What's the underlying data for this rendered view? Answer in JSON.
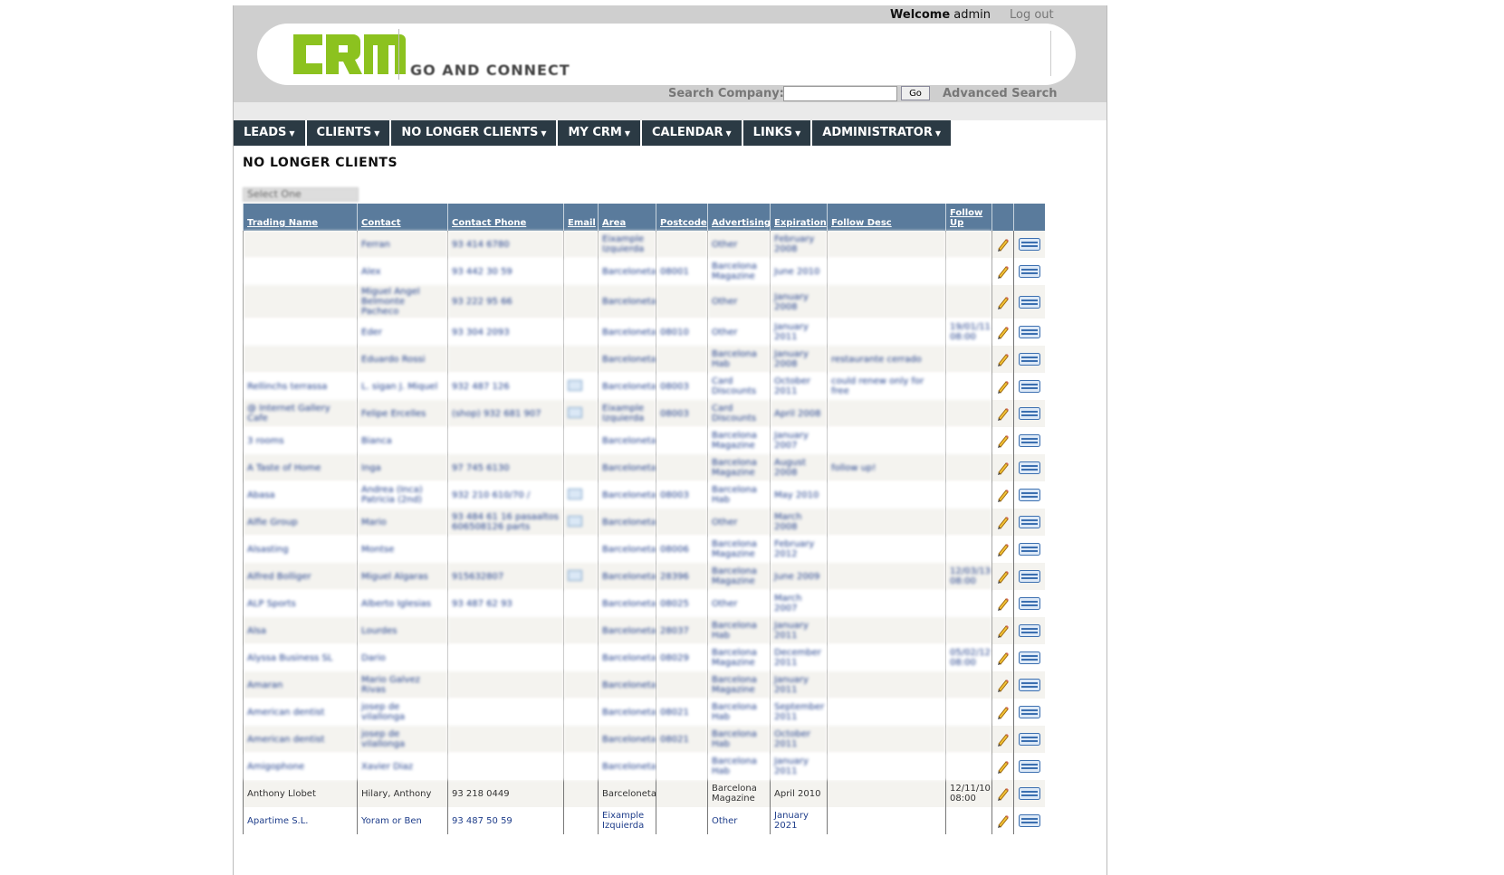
{
  "header": {
    "welcome_label": "Welcome",
    "username": "admin",
    "logout": "Log out",
    "logo_text": "CRM",
    "slogan": "GO AND CONNECT",
    "search_label": "Search Company:",
    "search_value": "",
    "go_button": "Go",
    "advanced_search": "Advanced Search"
  },
  "nav": [
    "LEADS",
    "CLIENTS",
    "NO LONGER CLIENTS",
    "MY CRM",
    "CALENDAR",
    "LINKS",
    "ADMINISTRATOR"
  ],
  "page_title": "NO LONGER CLIENTS",
  "filter_select": "Select One",
  "table": {
    "columns": [
      "Trading Name",
      "Contact",
      "Contact Phone",
      "Email",
      "Area",
      "Postcode",
      "Advertising",
      "Expiration",
      "Follow Desc",
      "Follow Up"
    ],
    "rows": [
      {
        "trading": "",
        "contact": "Ferran",
        "phone": "93 414 6780",
        "email": false,
        "area": "Eixample Izquierda",
        "postcode": "",
        "advertising": "Other",
        "expiration": "February 2008",
        "desc": "",
        "followup": ""
      },
      {
        "trading": "",
        "contact": "Alex",
        "phone": "93 442 30 59",
        "email": false,
        "area": "Barceloneta",
        "postcode": "08001",
        "advertising": "Barcelona Magazine",
        "expiration": "June 2010",
        "desc": "",
        "followup": ""
      },
      {
        "trading": "",
        "contact": "Miguel Angel Belmonte Pacheco",
        "phone": "93 222 95 66",
        "email": false,
        "area": "Barceloneta",
        "postcode": "",
        "advertising": "Other",
        "expiration": "January 2008",
        "desc": "",
        "followup": ""
      },
      {
        "trading": "",
        "contact": "Eder",
        "phone": "93 304 2093",
        "email": false,
        "area": "Barceloneta",
        "postcode": "08010",
        "advertising": "Other",
        "expiration": "January 2011",
        "desc": "",
        "followup": "19/01/11 08:00"
      },
      {
        "trading": "",
        "contact": "Eduardo Rossi",
        "phone": "",
        "email": false,
        "area": "Barceloneta",
        "postcode": "",
        "advertising": "Barcelona Hab",
        "expiration": "January 2008",
        "desc": "restaurante cerrado",
        "followup": ""
      },
      {
        "trading": "Rellinchs terrassa",
        "contact": "L. sigan J. Miquel",
        "phone": "932 487 126",
        "email": true,
        "area": "Barceloneta",
        "postcode": "08003",
        "advertising": "Card Discounts",
        "expiration": "October 2011",
        "desc": "could renew only for free",
        "followup": ""
      },
      {
        "trading": "@ Internet Gallery Cafe",
        "contact": "Felipe Ercelles",
        "phone": "(shop) 932 681 907",
        "email": true,
        "area": "Eixample Izquierda",
        "postcode": "08003",
        "advertising": "Card Discounts",
        "expiration": "April 2008",
        "desc": "",
        "followup": ""
      },
      {
        "trading": "3 rooms",
        "contact": "Bianca",
        "phone": "",
        "email": false,
        "area": "Barceloneta",
        "postcode": "",
        "advertising": "Barcelona Magazine",
        "expiration": "January 2007",
        "desc": "",
        "followup": ""
      },
      {
        "trading": "A Taste of Home",
        "contact": "Inga",
        "phone": "97 745 6130",
        "email": false,
        "area": "Barceloneta",
        "postcode": "",
        "advertising": "Barcelona Magazine",
        "expiration": "August 2008",
        "desc": "follow up!",
        "followup": ""
      },
      {
        "trading": "Abasa",
        "contact": "Andrea (Inca) Patricia (2nd)",
        "phone": "932 210 610/70 /",
        "email": true,
        "area": "Barceloneta",
        "postcode": "08003",
        "advertising": "Barcelona Hab",
        "expiration": "May 2010",
        "desc": "",
        "followup": ""
      },
      {
        "trading": "Alfie Group",
        "contact": "Mario",
        "phone": "93 484 61 16 pasaaltos 606508126 parts",
        "email": true,
        "area": "Barceloneta",
        "postcode": "",
        "advertising": "Other",
        "expiration": "March 2008",
        "desc": "",
        "followup": ""
      },
      {
        "trading": "Alsasting",
        "contact": "Montse",
        "phone": "",
        "email": false,
        "area": "Barceloneta",
        "postcode": "08006",
        "advertising": "Barcelona Magazine",
        "expiration": "February 2012",
        "desc": "",
        "followup": ""
      },
      {
        "trading": "Alfred Bolliger",
        "contact": "Miguel Algaras",
        "phone": "915632807",
        "email": true,
        "area": "Barceloneta",
        "postcode": "28396",
        "advertising": "Barcelona Magazine",
        "expiration": "June 2009",
        "desc": "",
        "followup": "12/03/13 08:00"
      },
      {
        "trading": "ALP Sports",
        "contact": "Alberto Iglesias",
        "phone": "93 487 62 93",
        "email": false,
        "area": "Barceloneta",
        "postcode": "08025",
        "advertising": "Other",
        "expiration": "March 2007",
        "desc": "",
        "followup": ""
      },
      {
        "trading": "Alsa",
        "contact": "Lourdes",
        "phone": "",
        "email": false,
        "area": "Barceloneta",
        "postcode": "28037",
        "advertising": "Barcelona Hab",
        "expiration": "January 2011",
        "desc": "",
        "followup": ""
      },
      {
        "trading": "Alyssa Business SL",
        "contact": "Dario",
        "phone": "",
        "email": false,
        "area": "Barceloneta",
        "postcode": "08029",
        "advertising": "Barcelona Magazine",
        "expiration": "December 2011",
        "desc": "",
        "followup": "05/02/12 08:00"
      },
      {
        "trading": "Amaran",
        "contact": "Mario Galvez Rivas",
        "phone": "",
        "email": false,
        "area": "Barceloneta",
        "postcode": "",
        "advertising": "Barcelona Magazine",
        "expiration": "January 2011",
        "desc": "",
        "followup": ""
      },
      {
        "trading": "American dentist",
        "contact": "josep de vilallonga",
        "phone": "",
        "email": false,
        "area": "Barceloneta",
        "postcode": "08021",
        "advertising": "Barcelona Hab",
        "expiration": "September 2011",
        "desc": "",
        "followup": ""
      },
      {
        "trading": "American dentist",
        "contact": "josep de vilallonga",
        "phone": "",
        "email": false,
        "area": "Barceloneta",
        "postcode": "08021",
        "advertising": "Barcelona Hab",
        "expiration": "October 2011",
        "desc": "",
        "followup": ""
      },
      {
        "trading": "Amigophone",
        "contact": "Xavier Diaz",
        "phone": "",
        "email": false,
        "area": "Barceloneta",
        "postcode": "",
        "advertising": "Barcelona Hab",
        "expiration": "January 2011",
        "desc": "",
        "followup": ""
      },
      {
        "trading": "Anthony Llobet",
        "contact": "Hilary, Anthony",
        "phone": "93 218 0449",
        "email": false,
        "area": "Barceloneta",
        "postcode": "",
        "advertising": "Barcelona Magazine",
        "expiration": "April 2010",
        "desc": "",
        "followup": "12/11/10 08:00"
      },
      {
        "trading": "Apartime S.L.",
        "contact": "Yoram or Ben",
        "phone": "93 487 50 59",
        "email": false,
        "area": "Eixample Izquierda",
        "postcode": "",
        "advertising": "Other",
        "expiration": "January 2021",
        "desc": "",
        "followup": ""
      }
    ],
    "blurred_row_count": 20
  },
  "colors": {
    "nav_bg": "#2b3a44",
    "table_header_bg": "#5a7b9c",
    "logo_green": "#8cc21f",
    "link_blue": "#1e3d8a"
  },
  "icons": {
    "edit": "pencil-icon",
    "view": "card-icon",
    "email": "envelope-icon"
  }
}
